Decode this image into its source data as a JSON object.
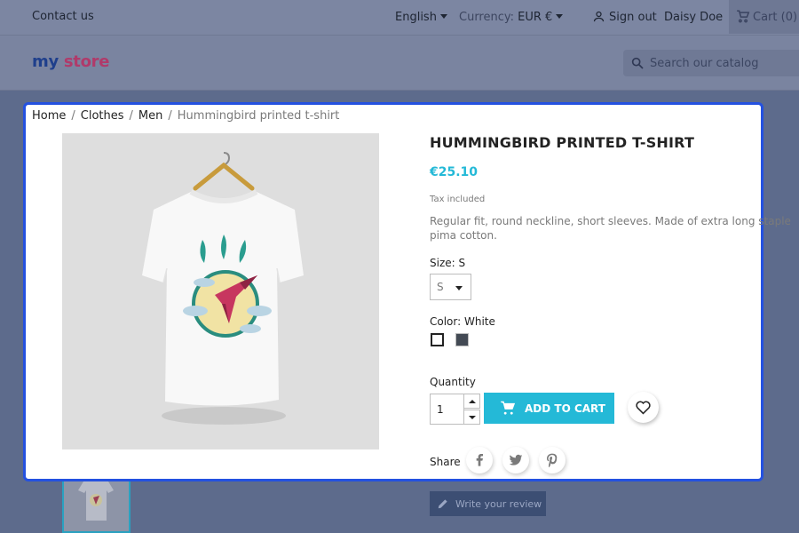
{
  "topbar": {
    "contact": "Contact us",
    "language": "English",
    "currency_label": "Currency:",
    "currency_value": "EUR €",
    "sign_out": "Sign out",
    "user_name": "Daisy Doe",
    "cart": "Cart (0)"
  },
  "header": {
    "logo_part1": "my",
    "logo_part2": "store",
    "search_placeholder": "Search our catalog"
  },
  "breadcrumb": [
    "Home",
    "Clothes",
    "Men",
    "Hummingbird printed t-shirt"
  ],
  "product": {
    "title": "HUMMINGBIRD PRINTED T-SHIRT",
    "price": "€25.10",
    "tax": "Tax included",
    "description": "Regular fit, round neckline, short sleeves. Made of extra long staple pima cotton.",
    "size_label": "Size: S",
    "size_value": "S",
    "color_label": "Color: White",
    "colors": [
      "#ffffff",
      "#434a54"
    ],
    "quantity_label": "Quantity",
    "quantity_value": "1",
    "add_to_cart": "ADD TO CART",
    "share_label": "Share",
    "write_review": "Write your review"
  },
  "colors": {
    "accent": "#24b9d7",
    "highlight_border": "#2451e0",
    "overlay": "#5d6b8c"
  }
}
